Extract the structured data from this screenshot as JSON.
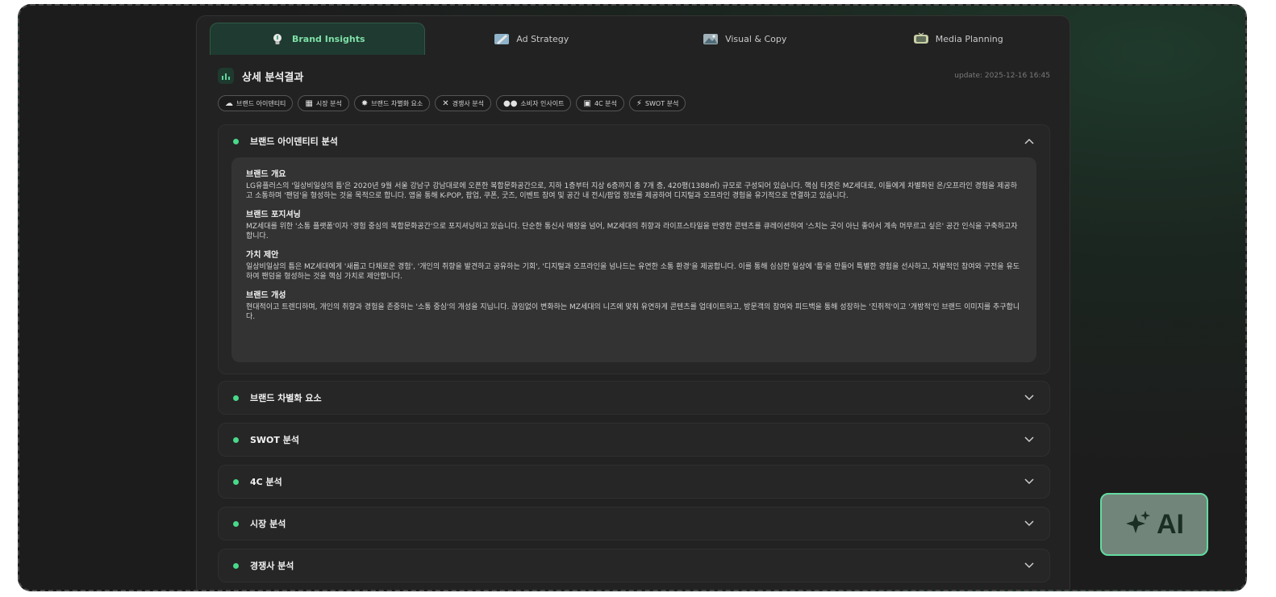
{
  "tabs": [
    {
      "label": "Brand Insights",
      "icon": "lightbulb-icon",
      "active": true
    },
    {
      "label": "Ad Strategy",
      "icon": "pencil-icon",
      "active": false
    },
    {
      "label": "Visual & Copy",
      "icon": "image-icon",
      "active": false
    },
    {
      "label": "Media Planning",
      "icon": "tv-icon",
      "active": false
    }
  ],
  "header": {
    "title": "상세 분석결과",
    "update": "update: 2025-12-16 16:45"
  },
  "chips": [
    {
      "label": "브랜드 아이덴티티",
      "icon": "brain-icon"
    },
    {
      "label": "시장 분석",
      "icon": "chart-board-icon"
    },
    {
      "label": "브랜드 차별화 요소",
      "icon": "sparkle-icon"
    },
    {
      "label": "경쟁사 분석",
      "icon": "swords-icon"
    },
    {
      "label": "소비자 인사이트",
      "icon": "users-icon"
    },
    {
      "label": "4C 분석",
      "icon": "grid-icon"
    },
    {
      "label": "SWOT 분석",
      "icon": "bolt-icon"
    }
  ],
  "open_section": {
    "title": "브랜드 아이덴티티 분석",
    "blocks": [
      {
        "title": "브랜드 개요",
        "text": "LG유플러스의 '일상비일상의 틈'은 2020년 9월 서울 강남구 강남대로에 오픈한 복합문화공간으로, 지하 1층부터 지상 6층까지 총 7개 층, 420평(1388㎡) 규모로 구성되어 있습니다. 핵심 타겟은 MZ세대로, 이들에게 차별화된 온/오프라인 경험을 제공하고 소통하며 '팬덤'을 형성하는 것을 목적으로 합니다. 앱을 통해 K-POP, 팝업, 쿠폰, 굿즈, 이벤트 참여 및 공간 내 전시/팝업 정보를 제공하여 디지털과 오프라인 경험을 유기적으로 연결하고 있습니다."
      },
      {
        "title": "브랜드 포지셔닝",
        "text": "MZ세대를 위한 '소통 플랫폼'이자 '경험 중심의 복합문화공간'으로 포지셔닝하고 있습니다. 단순한 통신사 매장을 넘어, MZ세대의 취향과 라이프스타일을 반영한 콘텐츠를 큐레이션하여 '스치는 곳이 아닌 좋아서 계속 머무르고 싶은' 공간 인식을 구축하고자 합니다."
      },
      {
        "title": "가치 제안",
        "text": "일상비일상의 틈은 MZ세대에게 '새롭고 다채로운 경험', '개인의 취향을 발견하고 공유하는 기회', '디지털과 오프라인을 넘나드는 유연한 소통 환경'을 제공합니다. 이를 통해 심심한 일상에 '틈'을 만들어 특별한 경험을 선사하고, 자발적인 참여와 구전을 유도하여 팬덤을 형성하는 것을 핵심 가치로 제안합니다."
      },
      {
        "title": "브랜드 개성",
        "text": "현대적이고 트렌디하며, 개인의 취향과 경험을 존중하는 '소통 중심'의 개성을 지닙니다. 끊임없이 변화하는 MZ세대의 니즈에 맞춰 유연하게 콘텐츠를 업데이트하고, 방문객의 참여와 피드백을 통해 성장하는 '진취적'이고 '개방적'인 브랜드 이미지를 추구합니다."
      }
    ]
  },
  "collapsed_sections": [
    {
      "title": "브랜드 차별화 요소"
    },
    {
      "title": "SWOT 분석"
    },
    {
      "title": "4C 분석"
    },
    {
      "title": "시장 분석"
    },
    {
      "title": "경쟁사 분석"
    }
  ],
  "ai_button": {
    "label": "AI",
    "icon": "sparkle-icon"
  },
  "colors": {
    "accent": "#49d98b",
    "panel": "#222222",
    "active_tab": "#1f3a30"
  }
}
